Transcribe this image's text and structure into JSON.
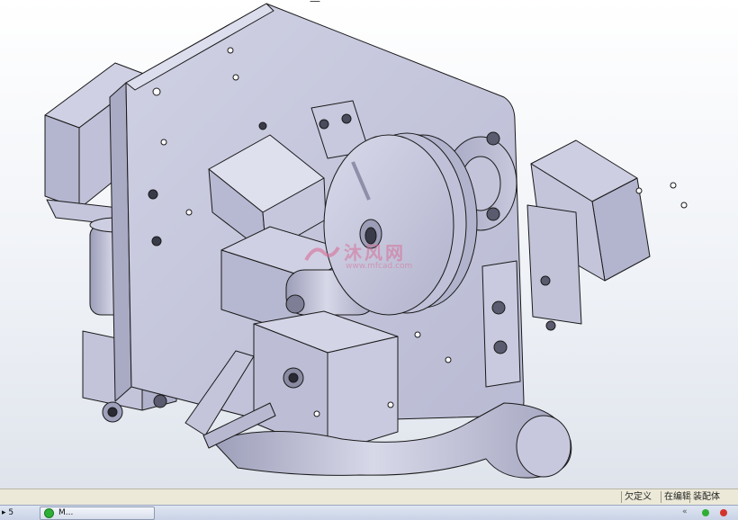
{
  "viewport": {
    "model_description_icon": "cad-assembly-model",
    "background_color": "#eef1f6",
    "part_color": "#c9cadf",
    "edge_color": "#1a1a1a"
  },
  "watermark": {
    "brand_text": "沐风网",
    "url_text": "www.mfcad.com",
    "color": "#d76e96"
  },
  "statusbar": {
    "cells": [
      {
        "label": "欠定义"
      },
      {
        "label": "在编辑"
      },
      {
        "label": "装配体"
      }
    ]
  },
  "taskbar": {
    "left_label": "▸ 5",
    "app_button_label": "M...",
    "tray_icons": [
      "chevron-icon",
      "green-status-icon",
      "red-status-icon"
    ]
  }
}
